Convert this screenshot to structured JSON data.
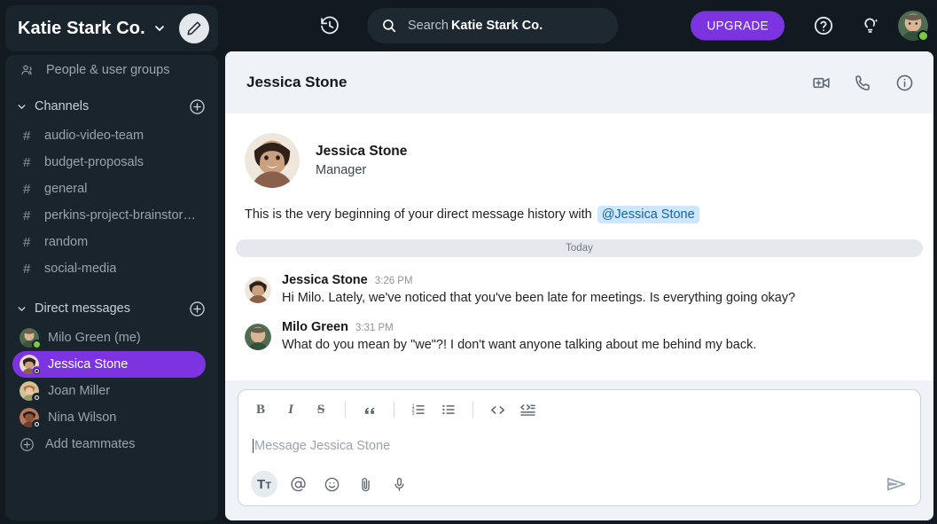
{
  "workspace": {
    "name": "Katie Stark Co.",
    "caret_icon": "chevron-down-icon",
    "compose_icon": "pencil-icon"
  },
  "sidebar": {
    "nav": [
      {
        "label": "People & user groups",
        "icon": "people-icon"
      }
    ],
    "channels_section": {
      "label": "Channels",
      "add_icon": "plus-circle-icon"
    },
    "channels": [
      {
        "label": "audio-video-team"
      },
      {
        "label": "budget-proposals"
      },
      {
        "label": "general"
      },
      {
        "label": "perkins-project-brainstor…"
      },
      {
        "label": "random"
      },
      {
        "label": "social-media"
      }
    ],
    "dms_section": {
      "label": "Direct messages",
      "add_icon": "plus-circle-icon"
    },
    "dms": [
      {
        "label": "Milo Green (me)",
        "status": "online",
        "active": false
      },
      {
        "label": "Jessica Stone",
        "status": "offline",
        "active": true
      },
      {
        "label": "Joan Miller",
        "status": "offline",
        "active": false
      },
      {
        "label": "Nina Wilson",
        "status": "offline",
        "active": false
      }
    ],
    "add_teammates": {
      "label": "Add teammates",
      "icon": "plus-circle-icon"
    }
  },
  "topbar": {
    "history_icon": "history-clock-icon",
    "search": {
      "icon": "search-icon",
      "placeholder": "Search",
      "scope": "Katie Stark Co."
    },
    "upgrade_label": "UPGRADE",
    "help_icon": "question-circle-icon",
    "ideas_icon": "lightbulb-sparkle-icon",
    "avatar_name": "user-avatar",
    "avatar_status": "online"
  },
  "conversation": {
    "title": "Jessica Stone",
    "actions": [
      {
        "name": "video-call-icon"
      },
      {
        "name": "phone-call-icon"
      },
      {
        "name": "info-icon"
      }
    ]
  },
  "intro": {
    "name": "Jessica Stone",
    "role": "Manager",
    "text": "This is the very beginning of your direct message history with",
    "mention": "@Jessica Stone"
  },
  "divider_label": "Today",
  "messages": [
    {
      "author": "Jessica Stone",
      "time": "3:26 PM",
      "text": "Hi Milo. Lately, we've noticed that you've been late for meetings. Is everything going okay?"
    },
    {
      "author": "Milo Green",
      "time": "3:31 PM",
      "text": "What do you mean by \"we\"?! I don't want anyone talking about me behind my back."
    }
  ],
  "composer": {
    "format_buttons": [
      {
        "name": "bold-icon",
        "label": "B"
      },
      {
        "name": "italic-icon",
        "label": "I"
      },
      {
        "name": "strikethrough-icon",
        "label": "S"
      },
      {
        "name": "blockquote-icon",
        "label": "””"
      },
      {
        "name": "ordered-list-icon",
        "label": ""
      },
      {
        "name": "bullet-list-icon",
        "label": ""
      },
      {
        "name": "code-icon",
        "label": "<>"
      },
      {
        "name": "code-block-icon",
        "label": ""
      }
    ],
    "placeholder": "Message Jessica Stone",
    "action_buttons": [
      {
        "name": "text-format-icon",
        "label": "Tᴛ"
      },
      {
        "name": "mention-icon",
        "label": "@"
      },
      {
        "name": "emoji-icon",
        "label": ""
      },
      {
        "name": "attach-icon",
        "label": ""
      },
      {
        "name": "microphone-icon",
        "label": ""
      }
    ],
    "send_icon": "send-arrow-icon"
  },
  "colors": {
    "accent_purple": "#7b34e0",
    "sidebar_bg": "#121a21",
    "panel_bg": "#1a242c",
    "header_bg": "#eff3f7",
    "online_green": "#7ac943",
    "mention_bg": "#cfe7fb",
    "mention_fg": "#1263a8"
  }
}
